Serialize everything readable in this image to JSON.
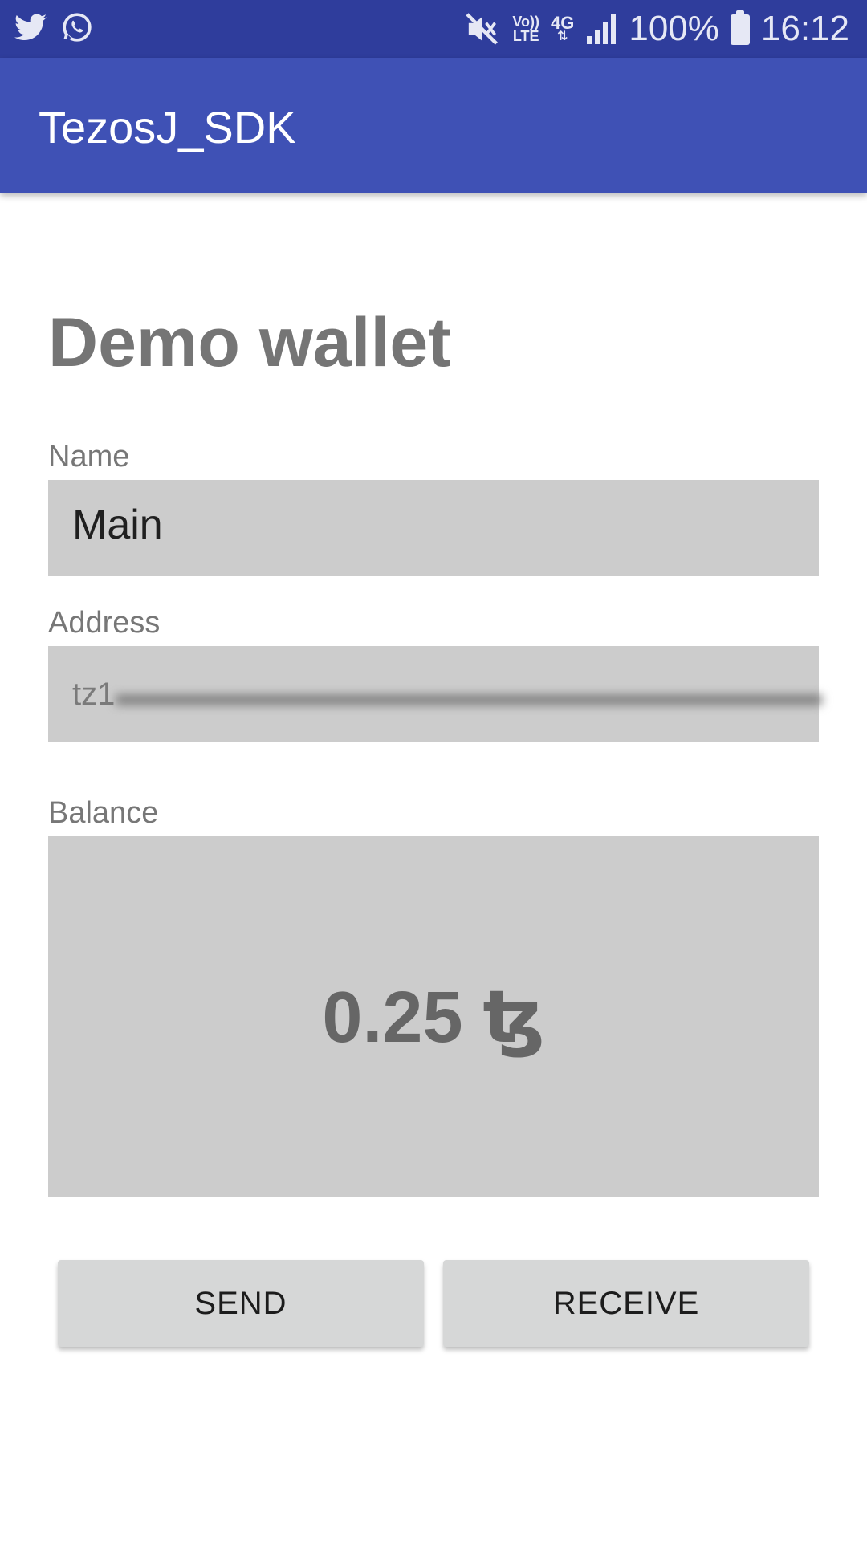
{
  "status_bar": {
    "left_icons": [
      "twitter-icon",
      "whatsapp-icon"
    ],
    "volte_top": "Vo))",
    "volte_bottom": "LTE",
    "network_label": "4G",
    "battery_percent": "100%",
    "time": "16:12"
  },
  "app_bar": {
    "title": "TezosJ_SDK",
    "color": "#3f51b5"
  },
  "wallet": {
    "heading": "Demo wallet",
    "name_label": "Name",
    "name_value": "Main",
    "address_label": "Address",
    "address_prefix": "tz1",
    "balance_label": "Balance",
    "balance_value": "0.25 ꜩ"
  },
  "actions": {
    "send_label": "SEND",
    "receive_label": "RECEIVE"
  }
}
